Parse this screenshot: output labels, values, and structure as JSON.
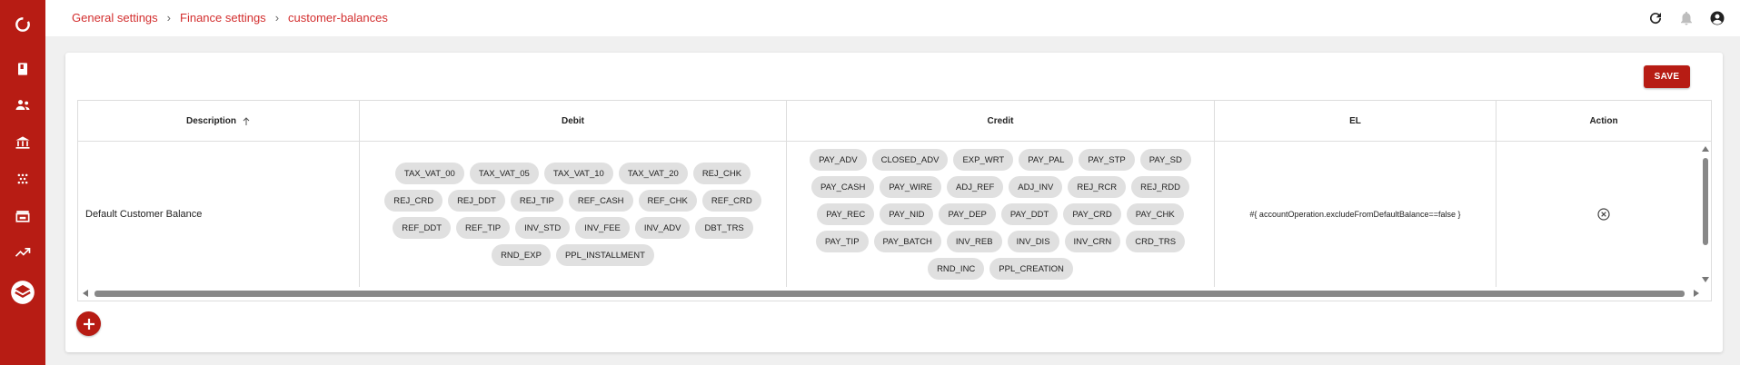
{
  "sidebar": {
    "items": [
      {
        "icon": "app-logo-icon"
      },
      {
        "icon": "book-icon"
      },
      {
        "icon": "people-icon"
      },
      {
        "icon": "bank-icon"
      },
      {
        "icon": "dots-grid-icon"
      },
      {
        "icon": "store-icon"
      },
      {
        "icon": "trending-up-icon"
      },
      {
        "icon": "layers-icon"
      }
    ]
  },
  "breadcrumb": {
    "items": [
      "General settings",
      "Finance settings",
      "customer-balances"
    ]
  },
  "topbar": {
    "icons": [
      "refresh-icon",
      "bell-icon",
      "account-icon"
    ]
  },
  "toolbar": {
    "save_label": "SAVE"
  },
  "table": {
    "headers": {
      "description": "Description",
      "debit": "Debit",
      "credit": "Credit",
      "el": "EL",
      "action": "Action"
    },
    "rows": [
      {
        "description": "Default Customer Balance",
        "debit": [
          "TAX_VAT_00",
          "TAX_VAT_05",
          "TAX_VAT_10",
          "TAX_VAT_20",
          "REJ_CHK",
          "REJ_CRD",
          "REJ_DDT",
          "REJ_TIP",
          "REF_CASH",
          "REF_CHK",
          "REF_CRD",
          "REF_DDT",
          "REF_TIP",
          "INV_STD",
          "INV_FEE",
          "INV_ADV",
          "DBT_TRS",
          "RND_EXP",
          "PPL_INSTALLMENT"
        ],
        "credit": [
          "PAY_ADV",
          "CLOSED_ADV",
          "EXP_WRT",
          "PAY_PAL",
          "PAY_STP",
          "PAY_SD",
          "PAY_CASH",
          "PAY_WIRE",
          "ADJ_REF",
          "ADJ_INV",
          "REJ_RCR",
          "REJ_RDD",
          "PAY_REC",
          "PAY_NID",
          "PAY_DEP",
          "PAY_DDT",
          "PAY_CRD",
          "PAY_CHK",
          "PAY_TIP",
          "PAY_BATCH",
          "INV_REB",
          "INV_DIS",
          "INV_CRN",
          "CRD_TRS",
          "RND_INC",
          "PPL_CREATION"
        ],
        "el": "#{ accountOperation.excludeFromDefaultBalance==false }"
      }
    ]
  },
  "colors": {
    "accent": "#b71c14",
    "link": "#d32f2f"
  }
}
